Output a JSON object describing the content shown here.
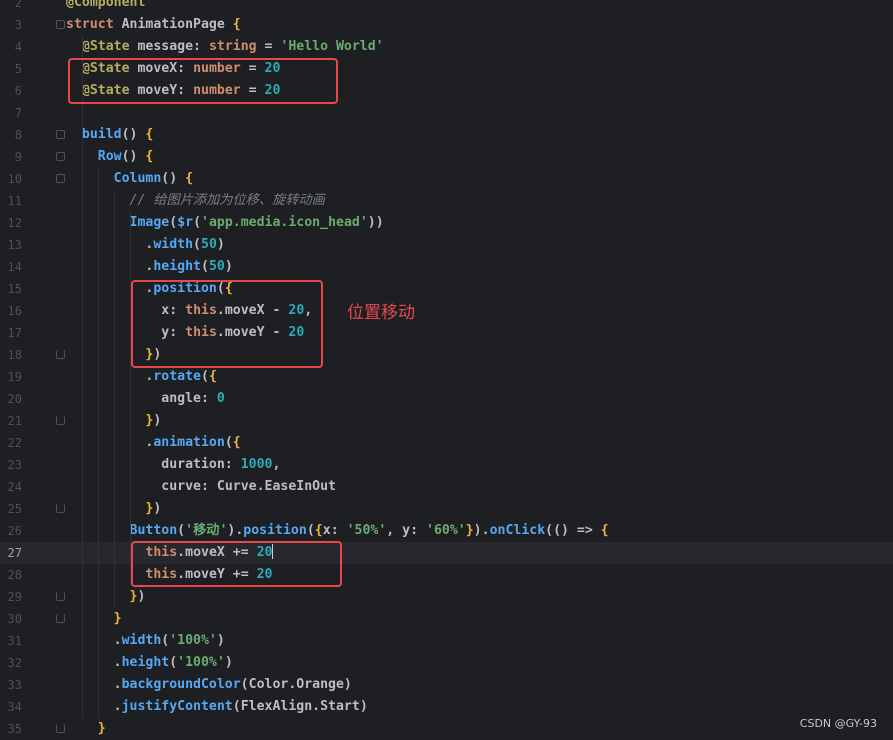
{
  "editor": {
    "current_line": 27,
    "lines": [
      {
        "n": 2,
        "tokens": [
          [
            "ann",
            "@Component"
          ]
        ]
      },
      {
        "n": 3,
        "tokens": [
          [
            "kw",
            "struct "
          ],
          [
            "cls",
            "AnimationPage "
          ],
          [
            "brace",
            "{"
          ]
        ]
      },
      {
        "n": 4,
        "tokens": [
          [
            "op",
            "  "
          ],
          [
            "ann",
            "@State "
          ],
          [
            "id",
            "message"
          ],
          [
            "op",
            ": "
          ],
          [
            "kw",
            "string"
          ],
          [
            "op",
            " = "
          ],
          [
            "str",
            "'Hello World'"
          ]
        ]
      },
      {
        "n": 5,
        "tokens": [
          [
            "op",
            "  "
          ],
          [
            "ann",
            "@State "
          ],
          [
            "id",
            "moveX"
          ],
          [
            "op",
            ": "
          ],
          [
            "kw",
            "number"
          ],
          [
            "op",
            " = "
          ],
          [
            "num",
            "20"
          ]
        ]
      },
      {
        "n": 6,
        "tokens": [
          [
            "op",
            "  "
          ],
          [
            "ann",
            "@State "
          ],
          [
            "id",
            "moveY"
          ],
          [
            "op",
            ": "
          ],
          [
            "kw",
            "number"
          ],
          [
            "op",
            " = "
          ],
          [
            "num",
            "20"
          ]
        ]
      },
      {
        "n": 7,
        "tokens": []
      },
      {
        "n": 8,
        "tokens": [
          [
            "op",
            "  "
          ],
          [
            "fn",
            "build"
          ],
          [
            "paren",
            "() "
          ],
          [
            "brace",
            "{"
          ]
        ]
      },
      {
        "n": 9,
        "tokens": [
          [
            "op",
            "    "
          ],
          [
            "fn",
            "Row"
          ],
          [
            "paren",
            "() "
          ],
          [
            "brace",
            "{"
          ]
        ]
      },
      {
        "n": 10,
        "tokens": [
          [
            "op",
            "      "
          ],
          [
            "fn",
            "Column"
          ],
          [
            "paren",
            "() "
          ],
          [
            "brace",
            "{"
          ]
        ]
      },
      {
        "n": 11,
        "tokens": [
          [
            "op",
            "        "
          ],
          [
            "comment",
            "// 给图片添加为位移、旋转动画"
          ]
        ]
      },
      {
        "n": 12,
        "tokens": [
          [
            "op",
            "        "
          ],
          [
            "fn",
            "Image"
          ],
          [
            "paren",
            "("
          ],
          [
            "fn",
            "$r"
          ],
          [
            "paren",
            "("
          ],
          [
            "str",
            "'app.media.icon_head'"
          ],
          [
            "paren",
            "))"
          ]
        ]
      },
      {
        "n": 13,
        "tokens": [
          [
            "op",
            "          ."
          ],
          [
            "fn",
            "width"
          ],
          [
            "paren",
            "("
          ],
          [
            "num",
            "50"
          ],
          [
            "paren",
            ")"
          ]
        ]
      },
      {
        "n": 14,
        "tokens": [
          [
            "op",
            "          ."
          ],
          [
            "fn",
            "height"
          ],
          [
            "paren",
            "("
          ],
          [
            "num",
            "50"
          ],
          [
            "paren",
            ")"
          ]
        ]
      },
      {
        "n": 15,
        "tokens": [
          [
            "op",
            "          ."
          ],
          [
            "fn",
            "position"
          ],
          [
            "paren",
            "("
          ],
          [
            "brace",
            "{"
          ]
        ]
      },
      {
        "n": 16,
        "tokens": [
          [
            "op",
            "            "
          ],
          [
            "id",
            "x"
          ],
          [
            "op",
            ": "
          ],
          [
            "this",
            "this"
          ],
          [
            "op",
            "."
          ],
          [
            "id",
            "moveX"
          ],
          [
            "op",
            " - "
          ],
          [
            "num",
            "20"
          ],
          [
            "op",
            ","
          ]
        ]
      },
      {
        "n": 17,
        "tokens": [
          [
            "op",
            "            "
          ],
          [
            "id",
            "y"
          ],
          [
            "op",
            ": "
          ],
          [
            "this",
            "this"
          ],
          [
            "op",
            "."
          ],
          [
            "id",
            "moveY"
          ],
          [
            "op",
            " - "
          ],
          [
            "num",
            "20"
          ]
        ]
      },
      {
        "n": 18,
        "tokens": [
          [
            "op",
            "          "
          ],
          [
            "brace",
            "}"
          ],
          [
            "paren",
            ")"
          ]
        ]
      },
      {
        "n": 19,
        "tokens": [
          [
            "op",
            "          ."
          ],
          [
            "fn",
            "rotate"
          ],
          [
            "paren",
            "("
          ],
          [
            "brace",
            "{"
          ]
        ]
      },
      {
        "n": 20,
        "tokens": [
          [
            "op",
            "            "
          ],
          [
            "id",
            "angle"
          ],
          [
            "op",
            ": "
          ],
          [
            "num",
            "0"
          ]
        ]
      },
      {
        "n": 21,
        "tokens": [
          [
            "op",
            "          "
          ],
          [
            "brace",
            "}"
          ],
          [
            "paren",
            ")"
          ]
        ]
      },
      {
        "n": 22,
        "tokens": [
          [
            "op",
            "          ."
          ],
          [
            "fn",
            "animation"
          ],
          [
            "paren",
            "("
          ],
          [
            "brace",
            "{"
          ]
        ]
      },
      {
        "n": 23,
        "tokens": [
          [
            "op",
            "            "
          ],
          [
            "id",
            "duration"
          ],
          [
            "op",
            ": "
          ],
          [
            "num",
            "1000"
          ],
          [
            "op",
            ","
          ]
        ]
      },
      {
        "n": 24,
        "tokens": [
          [
            "op",
            "            "
          ],
          [
            "id",
            "curve"
          ],
          [
            "op",
            ": "
          ],
          [
            "cls",
            "Curve"
          ],
          [
            "op",
            "."
          ],
          [
            "id",
            "EaseInOut"
          ]
        ]
      },
      {
        "n": 25,
        "tokens": [
          [
            "op",
            "          "
          ],
          [
            "brace",
            "}"
          ],
          [
            "paren",
            ")"
          ]
        ]
      },
      {
        "n": 26,
        "tokens": [
          [
            "op",
            "        "
          ],
          [
            "fn",
            "Button"
          ],
          [
            "paren",
            "("
          ],
          [
            "str",
            "'移动'"
          ],
          [
            "paren",
            ")"
          ],
          [
            "op",
            "."
          ],
          [
            "fn",
            "position"
          ],
          [
            "paren",
            "("
          ],
          [
            "brace",
            "{"
          ],
          [
            "id",
            "x"
          ],
          [
            "op",
            ": "
          ],
          [
            "str",
            "'50%'"
          ],
          [
            "op",
            ", "
          ],
          [
            "id",
            "y"
          ],
          [
            "op",
            ": "
          ],
          [
            "str",
            "'60%'"
          ],
          [
            "brace",
            "}"
          ],
          [
            "paren",
            ")"
          ],
          [
            "op",
            "."
          ],
          [
            "fn",
            "onClick"
          ],
          [
            "paren",
            "(() "
          ],
          [
            "op",
            "=> "
          ],
          [
            "brace",
            "{"
          ]
        ]
      },
      {
        "n": 27,
        "tokens": [
          [
            "op",
            "          "
          ],
          [
            "this",
            "this"
          ],
          [
            "op",
            "."
          ],
          [
            "id",
            "moveX"
          ],
          [
            "op",
            " += "
          ],
          [
            "num",
            "20"
          ]
        ],
        "cursor": true
      },
      {
        "n": 28,
        "tokens": [
          [
            "op",
            "          "
          ],
          [
            "this",
            "this"
          ],
          [
            "op",
            "."
          ],
          [
            "id",
            "moveY"
          ],
          [
            "op",
            " += "
          ],
          [
            "num",
            "20"
          ]
        ]
      },
      {
        "n": 29,
        "tokens": [
          [
            "op",
            "        "
          ],
          [
            "brace",
            "}"
          ],
          [
            "paren",
            ")"
          ]
        ]
      },
      {
        "n": 30,
        "tokens": [
          [
            "op",
            "      "
          ],
          [
            "brace",
            "}"
          ]
        ]
      },
      {
        "n": 31,
        "tokens": [
          [
            "op",
            "      ."
          ],
          [
            "fn",
            "width"
          ],
          [
            "paren",
            "("
          ],
          [
            "str",
            "'100%'"
          ],
          [
            "paren",
            ")"
          ]
        ]
      },
      {
        "n": 32,
        "tokens": [
          [
            "op",
            "      ."
          ],
          [
            "fn",
            "height"
          ],
          [
            "paren",
            "("
          ],
          [
            "str",
            "'100%'"
          ],
          [
            "paren",
            ")"
          ]
        ]
      },
      {
        "n": 33,
        "tokens": [
          [
            "op",
            "      ."
          ],
          [
            "fn",
            "backgroundColor"
          ],
          [
            "paren",
            "("
          ],
          [
            "cls",
            "Color"
          ],
          [
            "op",
            "."
          ],
          [
            "id",
            "Orange"
          ],
          [
            "paren",
            ")"
          ]
        ]
      },
      {
        "n": 34,
        "tokens": [
          [
            "op",
            "      ."
          ],
          [
            "fn",
            "justifyContent"
          ],
          [
            "paren",
            "("
          ],
          [
            "cls",
            "FlexAlign"
          ],
          [
            "op",
            "."
          ],
          [
            "id",
            "Start"
          ],
          [
            "paren",
            ")"
          ]
        ]
      },
      {
        "n": 35,
        "tokens": [
          [
            "op",
            "    "
          ],
          [
            "brace",
            "}"
          ]
        ]
      }
    ]
  },
  "annotation_label": "位置移动",
  "watermark": "CSDN @GY-93",
  "colors": {
    "background": "#1e1f22",
    "highlight_box": "#e5484d",
    "keyword": "#cf8e6d",
    "string": "#6aab73",
    "number": "#2aacb8",
    "function": "#56a8f5"
  }
}
